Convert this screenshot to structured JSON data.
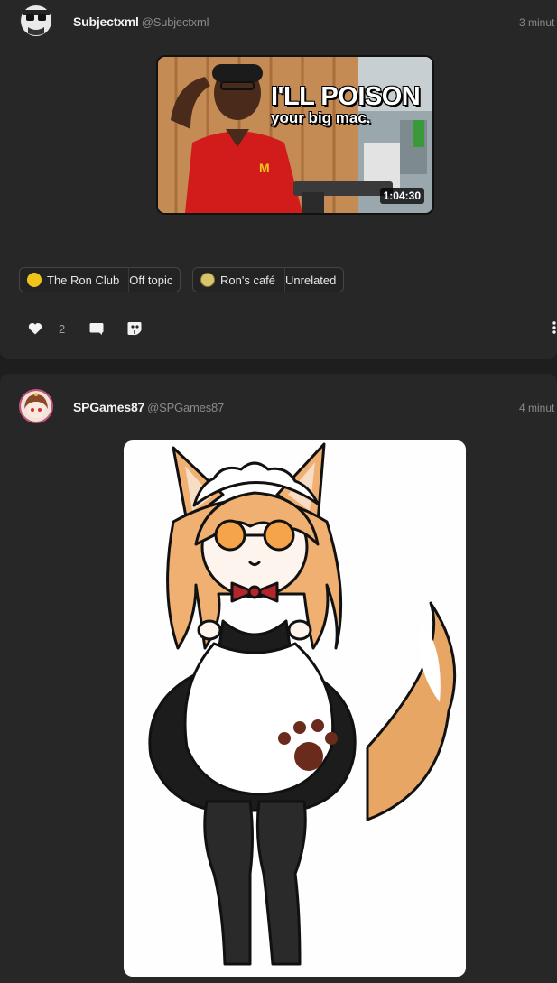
{
  "posts": [
    {
      "username": "Subjectxml",
      "handle": "@Subjectxml",
      "time": "3 minut",
      "video": {
        "headline": "I'LL POISON",
        "subline": "your big mac.",
        "duration": "1:04:30"
      },
      "tags": [
        {
          "community": "The Ron Club",
          "topic": "Off topic"
        },
        {
          "community": "Ron's café",
          "topic": "Unrelated"
        }
      ],
      "likes": "2"
    },
    {
      "username": "SPGames87",
      "handle": "@SPGames87",
      "time": "4 minut"
    }
  ],
  "colors": {
    "background": "#1e1e1e",
    "card": "#272727",
    "muted_text": "#8a8a8a",
    "tag_border": "#444444"
  },
  "icons": [
    "heart-icon",
    "comment-icon",
    "share-icon",
    "more-vertical-icon"
  ]
}
